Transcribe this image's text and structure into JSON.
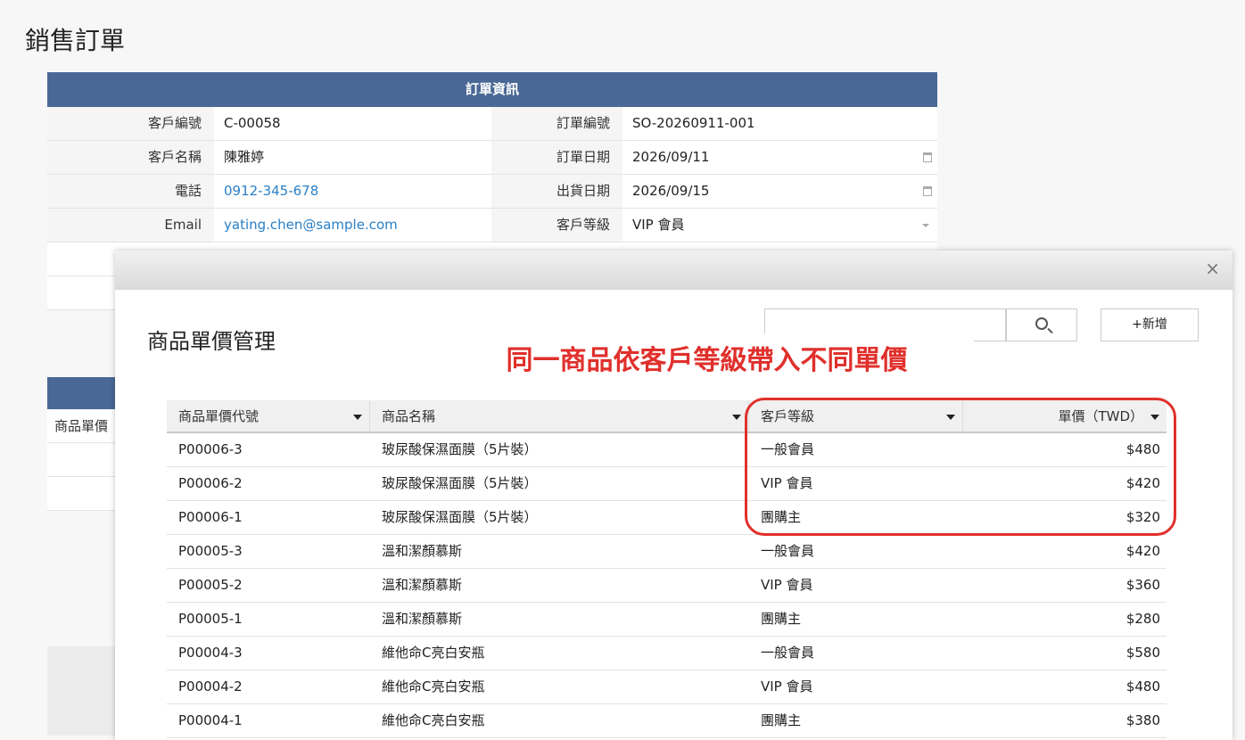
{
  "page": {
    "title": "銷售訂單"
  },
  "order_info": {
    "header": "訂單資訊",
    "rows": [
      {
        "left_label": "客戶編號",
        "left_value": "C-00058",
        "right_label": "訂單編號",
        "right_value": "SO-20260911-001"
      },
      {
        "left_label": "客戶名稱",
        "left_value": "陳雅婷",
        "right_label": "訂單日期",
        "right_value": "2026/09/11"
      },
      {
        "left_label": "電話",
        "left_value": "0912-345-678",
        "right_label": "出貨日期",
        "right_value": "2026/09/15"
      },
      {
        "left_label": "Email",
        "left_value": "yating.chen@sample.com",
        "right_label": "客戶等級",
        "right_value": "VIP 會員"
      }
    ]
  },
  "background_list": {
    "first_col_label": "商品單價"
  },
  "modal": {
    "title": "商品單價管理",
    "search": {
      "placeholder": ""
    },
    "add_label": "+新增",
    "close_label": "×",
    "callout": "同一商品依客戶等級帶入不同單價",
    "columns": [
      "商品單價代號",
      "商品名稱",
      "客戶等級",
      "單價（TWD）"
    ],
    "rows": [
      [
        "P00006-3",
        "玻尿酸保濕面膜（5片裝）",
        "一般會員",
        "$480"
      ],
      [
        "P00006-2",
        "玻尿酸保濕面膜（5片裝）",
        "VIP 會員",
        "$420"
      ],
      [
        "P00006-1",
        "玻尿酸保濕面膜（5片裝）",
        "團購主",
        "$320"
      ],
      [
        "P00005-3",
        "溫和潔顏慕斯",
        "一般會員",
        "$420"
      ],
      [
        "P00005-2",
        "溫和潔顏慕斯",
        "VIP 會員",
        "$360"
      ],
      [
        "P00005-1",
        "溫和潔顏慕斯",
        "團購主",
        "$280"
      ],
      [
        "P00004-3",
        "維他命C亮白安瓶",
        "一般會員",
        "$580"
      ],
      [
        "P00004-2",
        "維他命C亮白安瓶",
        "VIP 會員",
        "$480"
      ],
      [
        "P00004-1",
        "維他命C亮白安瓶",
        "團購主",
        "$380"
      ]
    ]
  },
  "colors": {
    "header_blue": "#4a6896",
    "link_blue": "#2a7fc7",
    "highlight_red": "#e0302c"
  }
}
